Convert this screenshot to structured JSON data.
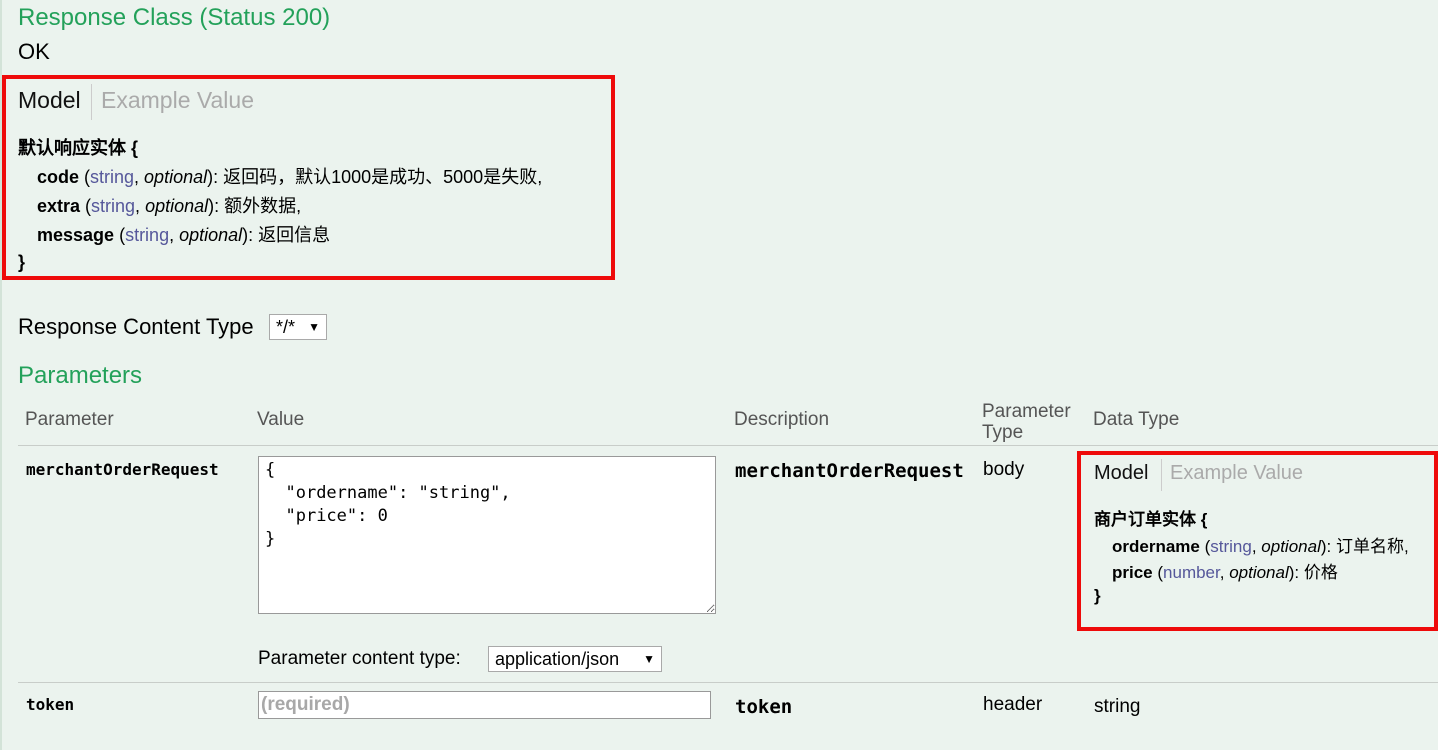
{
  "response_class": {
    "title": "Response Class (Status 200)",
    "status_text": "OK"
  },
  "response_model": {
    "tabs": [
      "Model",
      "Example Value"
    ],
    "name": "默认响应实体 {",
    "close": "}",
    "properties": [
      {
        "name": "code",
        "type": "string",
        "optional": "optional",
        "desc": "): 返回码，默认1000是成功、5000是失败,"
      },
      {
        "name": "extra",
        "type": "string",
        "optional": "optional",
        "desc": "): 额外数据,"
      },
      {
        "name": "message",
        "type": "string",
        "optional": "optional",
        "desc": "): 返回信息"
      }
    ]
  },
  "response_content_type": {
    "label": "Response Content Type",
    "selected": "*/*"
  },
  "parameters": {
    "title": "Parameters",
    "headers": [
      "Parameter",
      "Value",
      "Description",
      "Parameter",
      "Type",
      "Data Type"
    ],
    "rows": [
      {
        "name": "merchantOrderRequest",
        "value_lines": [
          "{",
          "  \"ordername\": \"string\",",
          "  \"price\": 0",
          "}"
        ],
        "description": "merchantOrderRequest",
        "param_type": "body",
        "content_type_label": "Parameter content type:",
        "content_type_selected": "application/json",
        "model": {
          "tabs": [
            "Model",
            "Example Value"
          ],
          "name": "商户订单实体 {",
          "close": "}",
          "properties": [
            {
              "name": "ordername",
              "type": "string",
              "optional": "optional",
              "desc": "): 订单名称,"
            },
            {
              "name": "price",
              "type": "number",
              "optional": "optional",
              "desc": "): 价格"
            }
          ]
        }
      },
      {
        "name": "token",
        "placeholder": "(required)",
        "description": "token",
        "param_type": "header",
        "data_type": "string"
      }
    ]
  },
  "colors": {
    "heading_green": "#23a15a",
    "highlight_red": "#ee0a0a",
    "type_purple": "#55579a",
    "background": "#ebf3ee"
  }
}
